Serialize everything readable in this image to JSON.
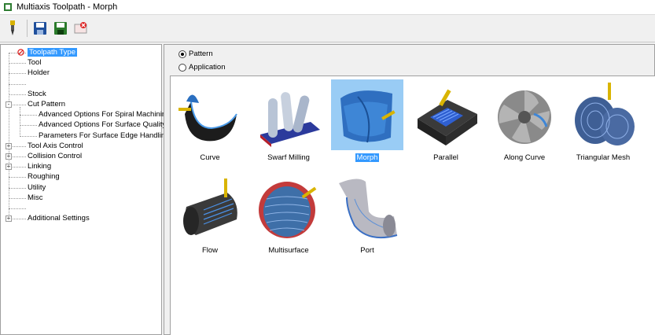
{
  "window": {
    "title": "Multiaxis Toolpath - Morph"
  },
  "toolbar": {
    "buttons": [
      {
        "name": "tool-icon"
      },
      {
        "name": "save-icon"
      },
      {
        "name": "save-as-icon"
      },
      {
        "name": "close-file-icon"
      }
    ]
  },
  "tree": {
    "items": [
      {
        "label": "Toolpath Type",
        "level": 1,
        "selected": true,
        "icon": "error-icon"
      },
      {
        "label": "Tool",
        "level": 1
      },
      {
        "label": "Holder",
        "level": 1
      },
      {
        "label": "",
        "level": 1
      },
      {
        "label": "Stock",
        "level": 1
      },
      {
        "label": "Cut Pattern",
        "level": 1,
        "expander": "-"
      },
      {
        "label": "Advanced Options For Spiral Machining",
        "level": 2
      },
      {
        "label": "Advanced Options For Surface Quality",
        "level": 2
      },
      {
        "label": "Parameters For Surface Edge Handling",
        "level": 2
      },
      {
        "label": "Tool Axis Control",
        "level": 1,
        "expander": "+"
      },
      {
        "label": "Collision Control",
        "level": 1,
        "expander": "+"
      },
      {
        "label": "Linking",
        "level": 1,
        "expander": "+"
      },
      {
        "label": "Roughing",
        "level": 1
      },
      {
        "label": "Utility",
        "level": 1
      },
      {
        "label": "Misc",
        "level": 1
      },
      {
        "label": "",
        "level": 1
      },
      {
        "label": "Additional Settings",
        "level": 1,
        "expander": "+"
      }
    ]
  },
  "mode": {
    "options": [
      {
        "label": "Pattern",
        "checked": true
      },
      {
        "label": "Application",
        "checked": false
      }
    ]
  },
  "gallery": {
    "tiles": [
      {
        "label": "Curve"
      },
      {
        "label": "Swarf Milling"
      },
      {
        "label": "Morph",
        "selected": true
      },
      {
        "label": "Parallel"
      },
      {
        "label": "Along Curve"
      },
      {
        "label": "Triangular Mesh"
      },
      {
        "label": "Flow"
      },
      {
        "label": "Multisurface"
      },
      {
        "label": "Port"
      }
    ]
  },
  "colors": {
    "selection": "#3399ff",
    "selection_tile_bg": "#99ccf5",
    "part_blue": "#3a6fc4"
  }
}
